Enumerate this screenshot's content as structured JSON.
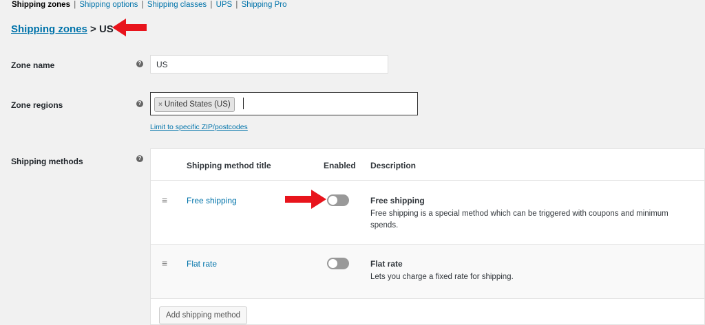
{
  "subnav": {
    "current": "Shipping zones",
    "links": [
      "Shipping options",
      "Shipping classes",
      "UPS",
      "Shipping Pro"
    ],
    "separator": "|"
  },
  "breadcrumb": {
    "parent": "Shipping zones",
    "separator": ">",
    "current": "US"
  },
  "zone_name": {
    "label": "Zone name",
    "value": "US"
  },
  "zone_regions": {
    "label": "Zone regions",
    "chip_remove": "×",
    "chip_label": "United States (US)",
    "limit_link": "Limit to specific ZIP/postcodes"
  },
  "help_icon_glyph": "?",
  "shipping_methods": {
    "label": "Shipping methods",
    "columns": {
      "title": "Shipping method title",
      "enabled": "Enabled",
      "description": "Description"
    },
    "rows": [
      {
        "title": "Free shipping",
        "enabled": false,
        "desc_title": "Free shipping",
        "desc_text": "Free shipping is a special method which can be triggered with coupons and minimum spends."
      },
      {
        "title": "Flat rate",
        "enabled": false,
        "desc_title": "Flat rate",
        "desc_text": "Lets you charge a fixed rate for shipping."
      }
    ],
    "add_button": "Add shipping method"
  },
  "colors": {
    "link": "#0073aa",
    "annotation_arrow": "#e8141c",
    "toggle_off": "#999999"
  },
  "icons": {
    "drag_handle": "drag-handle-icon",
    "help": "help-icon",
    "arrow": "annotation-arrow-icon"
  }
}
